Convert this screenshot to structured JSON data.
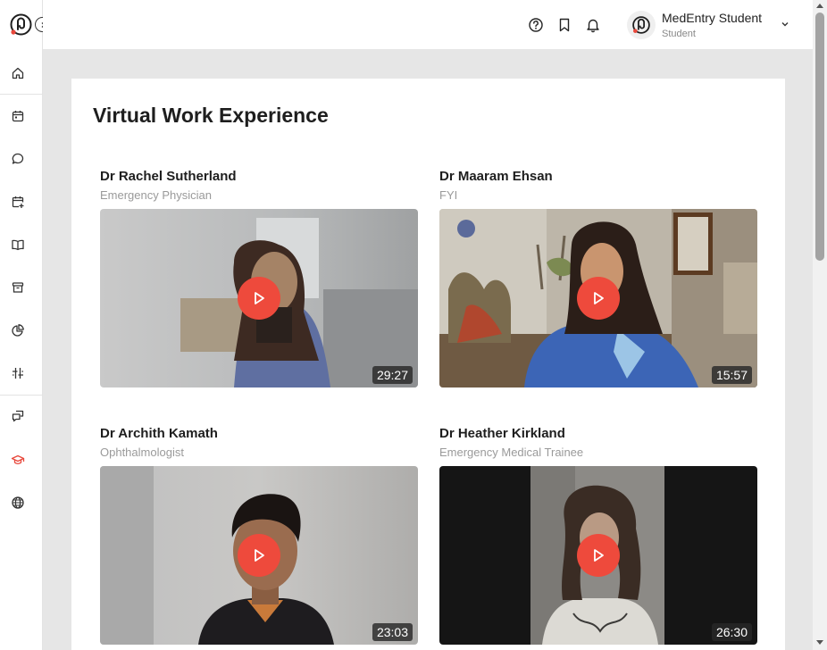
{
  "header": {
    "user_name": "MedEntry Student",
    "user_role": "Student"
  },
  "page": {
    "title": "Virtual Work Experience"
  },
  "videos": [
    {
      "name": "Dr Rachel Sutherland",
      "role": "Emergency Physician",
      "duration": "29:27"
    },
    {
      "name": "Dr Maaram Ehsan",
      "role": "FYI",
      "duration": "15:57"
    },
    {
      "name": "Dr Archith Kamath",
      "role": "Ophthalmologist",
      "duration": "23:03"
    },
    {
      "name": "Dr Heather Kirkland",
      "role": "Emergency Medical Trainee",
      "duration": "26:30"
    }
  ],
  "icons": {
    "sidebar": [
      "home-icon",
      "calendar-icon",
      "chat-icon",
      "calendar-add-icon",
      "book-icon",
      "archive-icon",
      "pie-chart-icon",
      "sliders-icon",
      "forum-icon",
      "graduation-cap-icon",
      "globe-icon"
    ],
    "header": [
      "help-icon",
      "bookmark-icon",
      "bell-icon",
      "chevron-down-icon"
    ]
  },
  "colors": {
    "accent": "#ee4a3c",
    "active_nav": "#e8473b"
  }
}
